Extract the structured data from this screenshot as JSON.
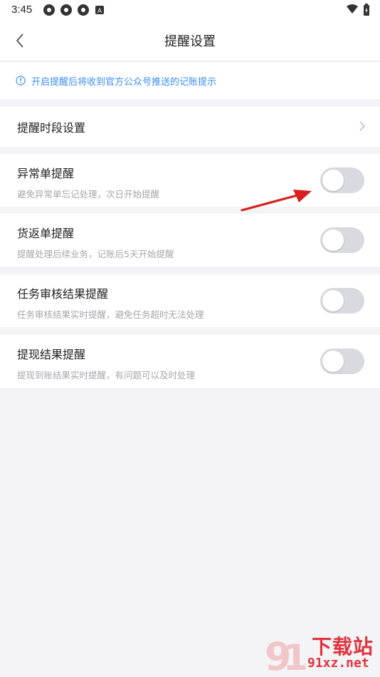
{
  "status_bar": {
    "time": "3:45"
  },
  "header": {
    "title": "提醒设置"
  },
  "notice": {
    "text": "开启提醒后将收到官方公众号推送的记账提示",
    "color": "#3a8ef6"
  },
  "period_row": {
    "label": "提醒时段设置"
  },
  "toggles": [
    {
      "title": "异常单提醒",
      "desc": "避免异常单忘记处理，次日开始提醒",
      "on": false
    },
    {
      "title": "货返单提醒",
      "desc": "提醒处理后续业务，记账后5天开始提醒",
      "on": false
    },
    {
      "title": "任务审核结果提醒",
      "desc": "任务审核结果实时提醒，避免任务超时无法处理",
      "on": false
    },
    {
      "title": "提现结果提醒",
      "desc": "提现到账结果实时提醒，有问题可以及时处理",
      "on": false
    }
  ],
  "watermark": {
    "top": "下载站",
    "bottom": "91xz.net"
  },
  "icons": [
    "back-arrow-icon",
    "info-icon",
    "chevron-right-icon",
    "wifi-icon",
    "battery-icon"
  ]
}
